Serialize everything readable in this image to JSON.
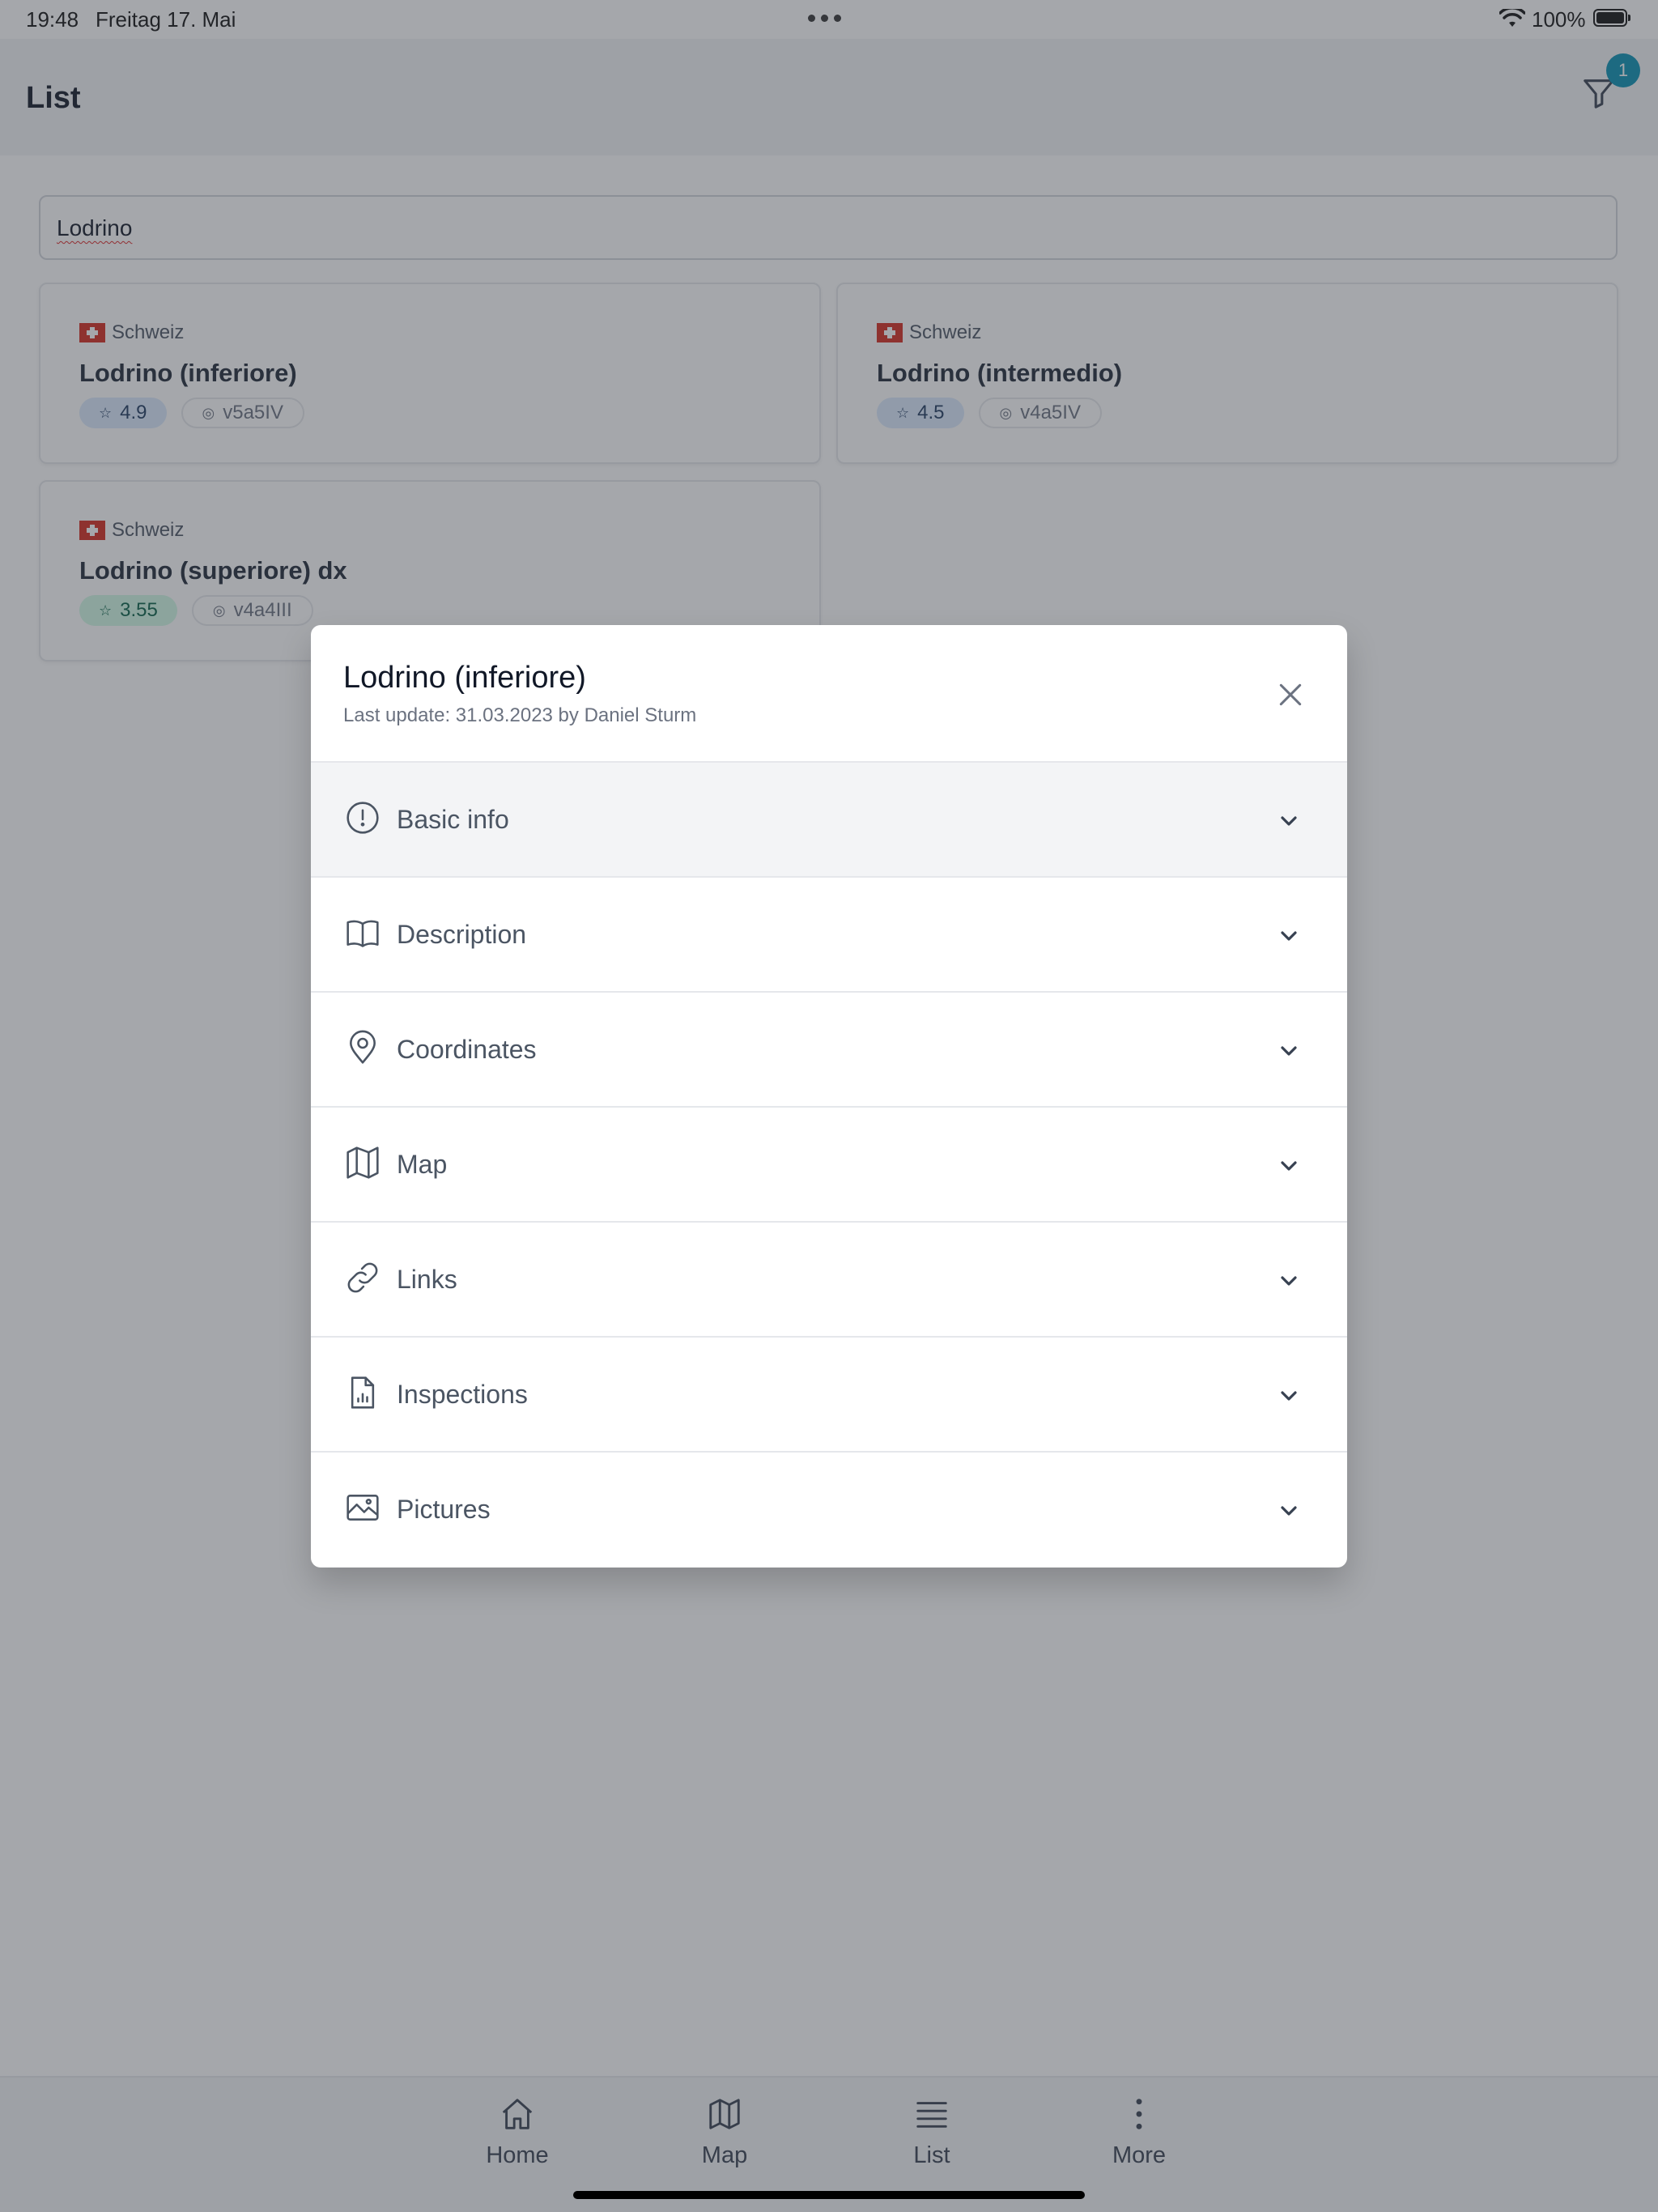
{
  "status_bar": {
    "time": "19:48",
    "date": "Freitag 17. Mai",
    "battery": "100%"
  },
  "header": {
    "title": "List",
    "filter_badge": "1"
  },
  "search": {
    "value": "Lodrino"
  },
  "cards": [
    {
      "country": "Schweiz",
      "name": "Lodrino (inferiore)",
      "rating": "4.9",
      "grade": "v5a5IV"
    },
    {
      "country": "Schweiz",
      "name": "Lodrino (intermedio)",
      "rating": "4.5",
      "grade": "v4a5IV"
    },
    {
      "country": "Schweiz",
      "name": "Lodrino (superiore) dx",
      "rating": "3.55",
      "grade": "v4a4III"
    }
  ],
  "modal": {
    "title": "Lodrino (inferiore)",
    "subtitle": "Last update: 31.03.2023 by Daniel Sturm",
    "sections": [
      {
        "label": "Basic info",
        "icon": "info-circle-icon"
      },
      {
        "label": "Description",
        "icon": "book-open-icon"
      },
      {
        "label": "Coordinates",
        "icon": "map-pin-icon"
      },
      {
        "label": "Map",
        "icon": "map-icon"
      },
      {
        "label": "Links",
        "icon": "link-icon"
      },
      {
        "label": "Inspections",
        "icon": "document-chart-icon"
      },
      {
        "label": "Pictures",
        "icon": "image-icon"
      }
    ]
  },
  "bottom_nav": [
    {
      "label": "Home",
      "icon": "home-icon"
    },
    {
      "label": "Map",
      "icon": "map-icon"
    },
    {
      "label": "List",
      "icon": "list-icon"
    },
    {
      "label": "More",
      "icon": "more-vertical-icon"
    }
  ],
  "colors": {
    "accent": "#0891b2",
    "overlay": "#6b7280",
    "rating_blue_bg": "#dbeafe",
    "rating_green_bg": "#d1fae5",
    "flag_red": "#d52b1e"
  }
}
